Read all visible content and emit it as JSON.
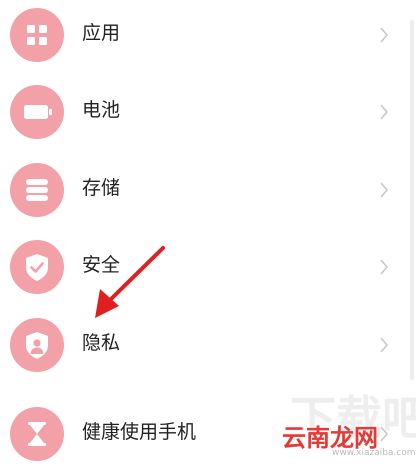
{
  "settings": {
    "items": [
      {
        "label": "应用",
        "icon": "apps-grid-icon"
      },
      {
        "label": "电池",
        "icon": "battery-icon"
      },
      {
        "label": "存储",
        "icon": "storage-icon"
      },
      {
        "label": "安全",
        "icon": "shield-check-icon"
      },
      {
        "label": "隐私",
        "icon": "privacy-shield-icon"
      },
      {
        "label": "健康使用手机",
        "icon": "hourglass-icon"
      }
    ]
  },
  "colors": {
    "icon_background": "#f3a1a8",
    "annotation_arrow": "#e02020",
    "watermark": "#e53935"
  },
  "watermark": {
    "text": "云南龙网",
    "ghost_text": "下载吧",
    "sub_text": "www.xiazaiba.com"
  }
}
